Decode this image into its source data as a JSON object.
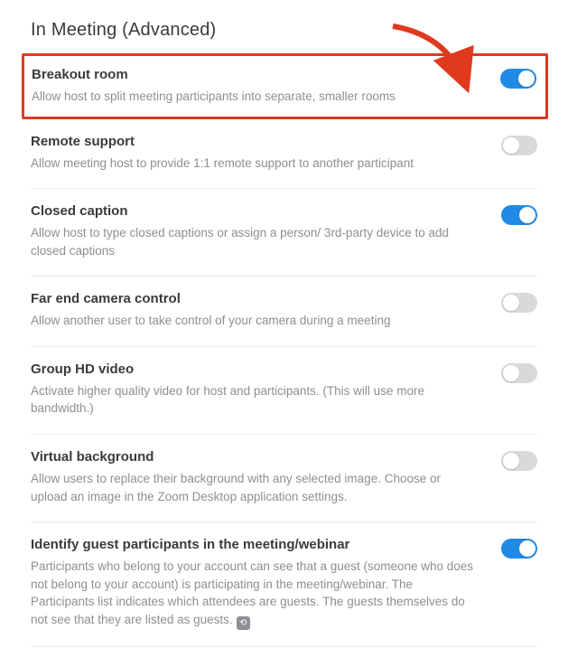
{
  "page": {
    "title": "In Meeting (Advanced)"
  },
  "settings": [
    {
      "key": "breakout-room",
      "title": "Breakout room",
      "desc": "Allow host to split meeting participants into separate, smaller rooms",
      "enabled": true,
      "highlighted": true
    },
    {
      "key": "remote-support",
      "title": "Remote support",
      "desc": "Allow meeting host to provide 1:1 remote support to another participant",
      "enabled": false
    },
    {
      "key": "closed-caption",
      "title": "Closed caption",
      "desc": "Allow host to type closed captions or assign a person/ 3rd-party device to add closed captions",
      "enabled": true
    },
    {
      "key": "far-end-camera",
      "title": "Far end camera control",
      "desc": "Allow another user to take control of your camera during a meeting",
      "enabled": false
    },
    {
      "key": "group-hd-video",
      "title": "Group HD video",
      "desc": "Activate higher quality video for host and participants. (This will use more bandwidth.)",
      "enabled": false
    },
    {
      "key": "virtual-background",
      "title": "Virtual background",
      "desc": "Allow users to replace their background with any selected image. Choose or upload an image in the Zoom Desktop application settings.",
      "enabled": false
    },
    {
      "key": "identify-guest",
      "title": "Identify guest participants in the meeting/webinar",
      "desc": "Participants who belong to your account can see that a guest (someone who does not belong to your account) is participating in the meeting/webinar. The Participants list indicates which attendees are guests. The guests themselves do not see that they are listed as guests.",
      "enabled": true,
      "has_reset_icon": true
    }
  ],
  "annotation": {
    "arrow_color": "#e0391e"
  }
}
